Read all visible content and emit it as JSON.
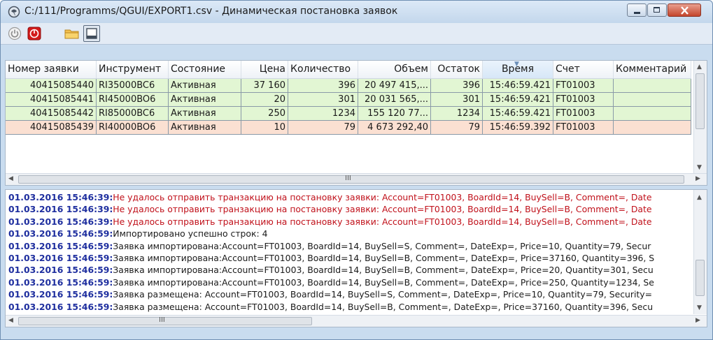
{
  "window": {
    "title": "C:/111/Programms/QGUI/EXPORT1.csv - Динамическая постановка заявок"
  },
  "toolbar": {
    "buttons": [
      "power-icon",
      "stop-icon",
      "folder-icon",
      "window-icon"
    ]
  },
  "grid": {
    "columns": [
      "Номер заявки",
      "Инструмент",
      "Состояние",
      "Цена",
      "Количество",
      "Объем",
      "Остаток",
      "Время",
      "Счет",
      "Комментарий"
    ],
    "rows": [
      {
        "cells": [
          "40415085440",
          "RI35000BC6",
          "Активная",
          "37 160",
          "396",
          "20 497 415,...",
          "396",
          "15:46:59.421",
          "FT01003",
          ""
        ],
        "color": "#e2f6d3"
      },
      {
        "cells": [
          "40415085441",
          "RI45000BO6",
          "Активная",
          "20",
          "301",
          "20 031 565,...",
          "301",
          "15:46:59.421",
          "FT01003",
          ""
        ],
        "color": "#e2f6d3"
      },
      {
        "cells": [
          "40415085442",
          "RI85000BC6",
          "Активная",
          "250",
          "1234",
          "155 120 77...",
          "1234",
          "15:46:59.421",
          "FT01003",
          ""
        ],
        "color": "#e2f6d3"
      },
      {
        "cells": [
          "40415085439",
          "RI40000BO6",
          "Активная",
          "10",
          "79",
          "4 673 292,40",
          "79",
          "15:46:59.392",
          "FT01003",
          ""
        ],
        "color": "#fbe0d2"
      }
    ],
    "hscroll_label": "III"
  },
  "log": {
    "lines": [
      {
        "ts": "01.03.2016 15:46:39:",
        "msg": "Не удалось отправить транзакцию на постановку заявки: Account=FT01003, BoardId=14, BuySell=B, Comment=, Date",
        "kind": "err"
      },
      {
        "ts": "01.03.2016 15:46:39:",
        "msg": "Не удалось отправить транзакцию на постановку заявки: Account=FT01003, BoardId=14, BuySell=B, Comment=, Date",
        "kind": "err"
      },
      {
        "ts": "01.03.2016 15:46:39:",
        "msg": "Не удалось отправить транзакцию на постановку заявки: Account=FT01003, BoardId=14, BuySell=B, Comment=, Date",
        "kind": "err"
      },
      {
        "ts": "01.03.2016 15:46:59:",
        "msg": "Импортировано успешно строк: 4",
        "kind": "info"
      },
      {
        "ts": "01.03.2016 15:46:59:",
        "msg": "Заявка импортирована:Account=FT01003, BoardId=14, BuySell=S, Comment=, DateExp=, Price=10, Quantity=79, Secur",
        "kind": "info"
      },
      {
        "ts": "01.03.2016 15:46:59:",
        "msg": "Заявка импортирована:Account=FT01003, BoardId=14, BuySell=B, Comment=, DateExp=, Price=37160, Quantity=396, S",
        "kind": "info"
      },
      {
        "ts": "01.03.2016 15:46:59:",
        "msg": "Заявка импортирована:Account=FT01003, BoardId=14, BuySell=B, Comment=, DateExp=, Price=20, Quantity=301, Secu",
        "kind": "info"
      },
      {
        "ts": "01.03.2016 15:46:59:",
        "msg": "Заявка импортирована:Account=FT01003, BoardId=14, BuySell=B, Comment=, DateExp=, Price=250, Quantity=1234, Se",
        "kind": "info"
      },
      {
        "ts": "01.03.2016 15:46:59:",
        "msg": "Заявка размещена: Account=FT01003, BoardId=14, BuySell=S, Comment=, DateExp=, Price=10, Quantity=79, Security=",
        "kind": "info"
      },
      {
        "ts": "01.03.2016 15:46:59:",
        "msg": "Заявка размещена: Account=FT01003, BoardId=14, BuySell=B, Comment=, DateExp=, Price=37160, Quantity=396, Secu",
        "kind": "info"
      }
    ],
    "hscroll_label": "III"
  }
}
